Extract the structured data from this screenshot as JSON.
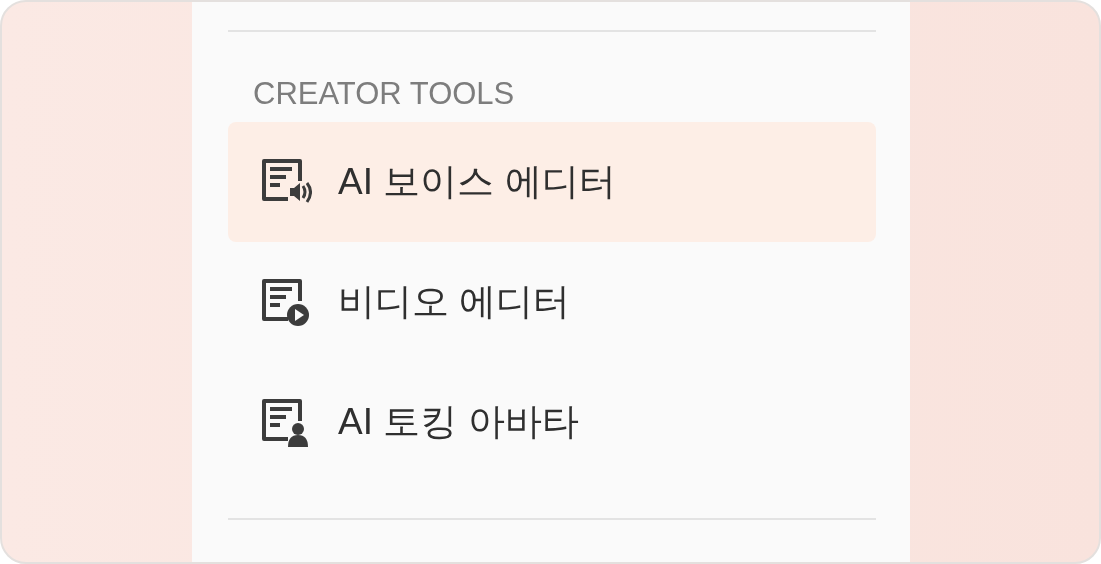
{
  "section": {
    "heading": "CREATOR TOOLS",
    "items": [
      {
        "label": "AI 보이스 에디터",
        "kind": "voice",
        "selected": true
      },
      {
        "label": "비디오 에디터",
        "kind": "video",
        "selected": false
      },
      {
        "label": "AI 토킹 아바타",
        "kind": "avatar",
        "selected": false
      }
    ]
  }
}
